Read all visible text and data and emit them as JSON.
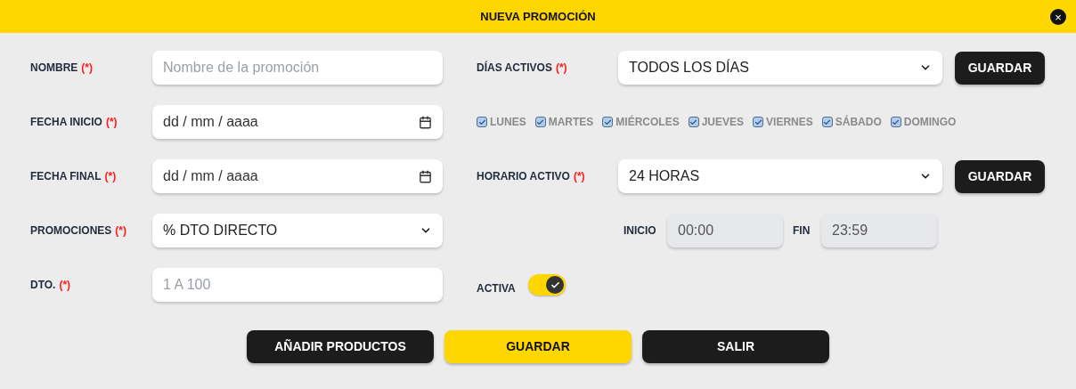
{
  "window": {
    "title": "NUEVA PROMOCIÓN",
    "close": "×"
  },
  "left_fields": [
    {
      "label": "NOMBRE",
      "required_mark": "(*)",
      "kind": "text",
      "placeholder": "Nombre de la promoción"
    },
    {
      "label": "FECHA INICIO",
      "required_mark": "(*)",
      "kind": "date",
      "value": "dd / mm / aaaa"
    },
    {
      "label": "FECHA FINAL",
      "required_mark": "(*)",
      "kind": "date",
      "value": "dd / mm / aaaa"
    },
    {
      "label": "PROMOCIONES",
      "required_mark": "(*)",
      "kind": "select",
      "value": "% DTO DIRECTO"
    },
    {
      "label": "DTO.",
      "required_mark": "(*)",
      "kind": "text",
      "placeholder": "1 A 100"
    }
  ],
  "active_days": {
    "label": "DÍAS ACTIVOS",
    "required_mark": "(*)",
    "value": "TODOS LOS DÍAS",
    "button": "GUARDAR"
  },
  "days": [
    {
      "label": "LUNES",
      "checked": true
    },
    {
      "label": "MARTES",
      "checked": true
    },
    {
      "label": "MIÉRCOLES",
      "checked": true
    },
    {
      "label": "JUEVES",
      "checked": true
    },
    {
      "label": "VIERNES",
      "checked": true
    },
    {
      "label": "SÁBADO",
      "checked": true
    },
    {
      "label": "DOMINGO",
      "checked": true
    }
  ],
  "active_hours": {
    "label": "HORARIO ACTIVO",
    "required_mark": "(*)",
    "value": "24 HORAS",
    "button": "GUARDAR"
  },
  "time_range": {
    "start_label": "INICIO",
    "start": "00:00",
    "end_label": "FIN",
    "end": "23:59"
  },
  "active": {
    "label": "ACTIVA",
    "on": true
  },
  "buttons": [
    {
      "label": "AÑADIR PRODUCTOS",
      "kind": "dark"
    },
    {
      "label": "GUARDAR",
      "kind": "primary"
    },
    {
      "label": "SALIR",
      "kind": "dark"
    }
  ]
}
